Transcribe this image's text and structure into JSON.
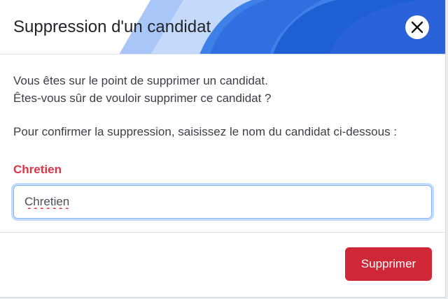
{
  "modal": {
    "title": "Suppression d'un candidat",
    "close_label": "×",
    "intro_line1": "Vous êtes sur le point de supprimer un candidat.",
    "intro_line2": "Êtes-vous sûr de vouloir supprimer ce candidat ?",
    "confirm_text": "Pour confirmer la suppression, saisissez le nom du candidat ci-dessous :",
    "candidate_name": "Chretien",
    "input_value": "Chretien",
    "delete_button": "Supprimer"
  },
  "colors": {
    "accent_blue": "#2f6fe0",
    "danger": "#cf2737",
    "focus_border": "#86b7fe"
  },
  "icons": {
    "close": "close-icon"
  }
}
